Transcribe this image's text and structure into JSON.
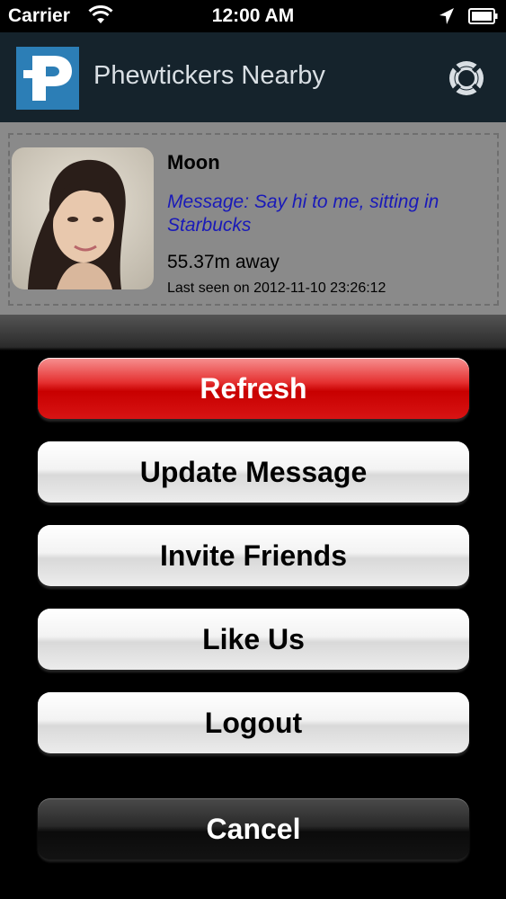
{
  "status_bar": {
    "carrier": "Carrier",
    "time": "12:00 AM",
    "icons": [
      "wifi-icon",
      "location-arrow-icon",
      "battery-icon"
    ]
  },
  "nav_bar": {
    "logo_icon": "phewtickers-p-logo-icon",
    "title": "Phewtickers Nearby",
    "help_icon": "lifebuoy-icon"
  },
  "user_card": {
    "name": "Moon",
    "message": "Message: Say hi to me, sitting in Starbucks",
    "distance": "55.37m away",
    "last_seen": "Last seen on 2012-11-10 23:26:12"
  },
  "action_sheet": {
    "refresh_label": "Refresh",
    "update_message_label": "Update Message",
    "invite_friends_label": "Invite Friends",
    "like_us_label": "Like Us",
    "logout_label": "Logout",
    "cancel_label": "Cancel"
  },
  "colors": {
    "nav_background": "#15232c",
    "logo_blue": "#2c7eb6",
    "message_text": "#1a1ab8",
    "destructive_red": "#c80000"
  }
}
